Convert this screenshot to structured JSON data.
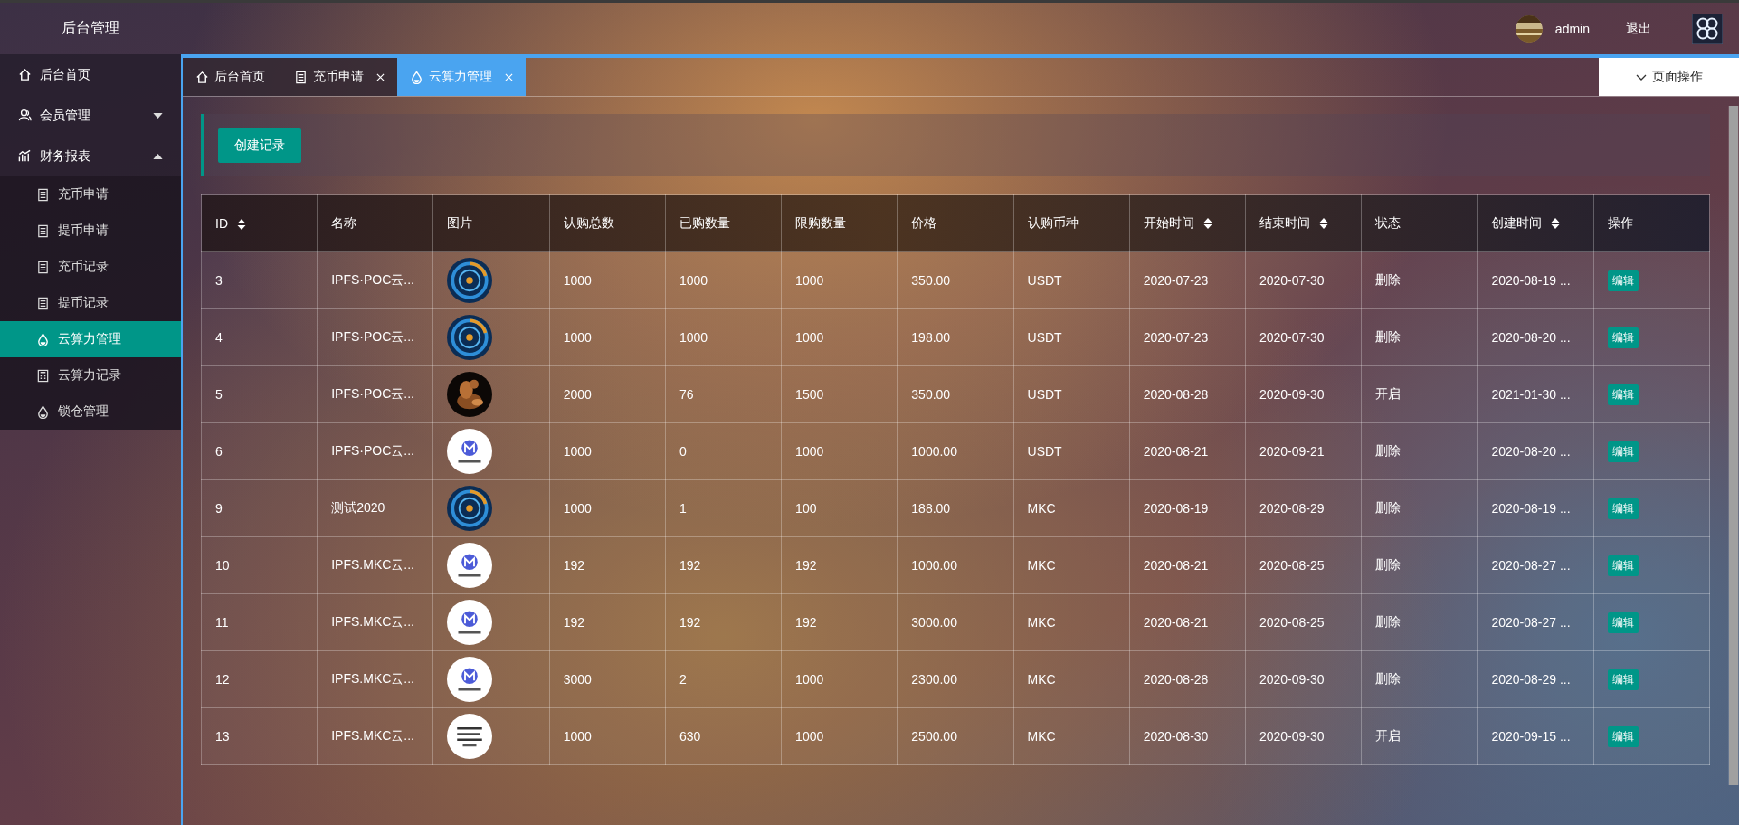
{
  "header": {
    "title": "后台管理",
    "user": "admin",
    "logout": "退出"
  },
  "sidebar": {
    "items": [
      {
        "label": "后台首页",
        "selected": false
      },
      {
        "label": "会员管理",
        "selected": false,
        "expanded": false
      },
      {
        "label": "财务报表",
        "selected": false,
        "expanded": true,
        "children": [
          {
            "label": "充币申请",
            "selected": false
          },
          {
            "label": "提币申请",
            "selected": false
          },
          {
            "label": "充币记录",
            "selected": false
          },
          {
            "label": "提币记录",
            "selected": false
          },
          {
            "label": "云算力管理",
            "selected": true
          },
          {
            "label": "云算力记录",
            "selected": false
          },
          {
            "label": "锁仓管理",
            "selected": false
          }
        ]
      }
    ]
  },
  "tabs": [
    {
      "label": "后台首页",
      "selected": false,
      "closable": false
    },
    {
      "label": "充币申请",
      "selected": false,
      "closable": true
    },
    {
      "label": "云算力管理",
      "selected": true,
      "closable": true
    }
  ],
  "page_actions": "页面操作",
  "create_button": "创建记录",
  "table": {
    "columns": [
      {
        "label": "ID",
        "sortable": true
      },
      {
        "label": "名称",
        "sortable": false
      },
      {
        "label": "图片",
        "sortable": false
      },
      {
        "label": "认购总数",
        "sortable": false
      },
      {
        "label": "已购数量",
        "sortable": false
      },
      {
        "label": "限购数量",
        "sortable": false
      },
      {
        "label": "价格",
        "sortable": false
      },
      {
        "label": "认购币种",
        "sortable": false
      },
      {
        "label": "开始时间",
        "sortable": true
      },
      {
        "label": "结束时间",
        "sortable": true
      },
      {
        "label": "状态",
        "sortable": false
      },
      {
        "label": "创建时间",
        "sortable": true
      },
      {
        "label": "操作",
        "sortable": false
      }
    ],
    "rows": [
      {
        "id": "3",
        "name": "IPFS·POC云...",
        "total": "1000",
        "bought": "1000",
        "limit": "1000",
        "price": "350.00",
        "coin": "USDT",
        "start": "2020-07-23",
        "end": "2020-07-30",
        "status": "删除",
        "created": "2020-08-19 ...",
        "action": "编辑"
      },
      {
        "id": "4",
        "name": "IPFS·POC云...",
        "total": "1000",
        "bought": "1000",
        "limit": "1000",
        "price": "198.00",
        "coin": "USDT",
        "start": "2020-07-23",
        "end": "2020-07-30",
        "status": "删除",
        "created": "2020-08-20 ...",
        "action": "编辑"
      },
      {
        "id": "5",
        "name": "IPFS·POC云...",
        "total": "2000",
        "bought": "76",
        "limit": "1500",
        "price": "350.00",
        "coin": "USDT",
        "start": "2020-08-28",
        "end": "2020-09-30",
        "status": "开启",
        "created": "2021-01-30 ...",
        "action": "编辑"
      },
      {
        "id": "6",
        "name": "IPFS·POC云...",
        "total": "1000",
        "bought": "0",
        "limit": "1000",
        "price": "1000.00",
        "coin": "USDT",
        "start": "2020-08-21",
        "end": "2020-09-21",
        "status": "删除",
        "created": "2020-08-20 ...",
        "action": "编辑"
      },
      {
        "id": "9",
        "name": "测试2020",
        "total": "1000",
        "bought": "1",
        "limit": "100",
        "price": "188.00",
        "coin": "MKC",
        "start": "2020-08-19",
        "end": "2020-08-29",
        "status": "删除",
        "created": "2020-08-19 ...",
        "action": "编辑"
      },
      {
        "id": "10",
        "name": "IPFS.MKC云...",
        "total": "192",
        "bought": "192",
        "limit": "192",
        "price": "1000.00",
        "coin": "MKC",
        "start": "2020-08-21",
        "end": "2020-08-25",
        "status": "删除",
        "created": "2020-08-27 ...",
        "action": "编辑"
      },
      {
        "id": "11",
        "name": "IPFS.MKC云...",
        "total": "192",
        "bought": "192",
        "limit": "192",
        "price": "3000.00",
        "coin": "MKC",
        "start": "2020-08-21",
        "end": "2020-08-25",
        "status": "删除",
        "created": "2020-08-27 ...",
        "action": "编辑"
      },
      {
        "id": "12",
        "name": "IPFS.MKC云...",
        "total": "3000",
        "bought": "2",
        "limit": "1000",
        "price": "2300.00",
        "coin": "MKC",
        "start": "2020-08-28",
        "end": "2020-09-30",
        "status": "删除",
        "created": "2020-08-29 ...",
        "action": "编辑"
      },
      {
        "id": "13",
        "name": "IPFS.MKC云...",
        "total": "1000",
        "bought": "630",
        "limit": "1000",
        "price": "2500.00",
        "coin": "MKC",
        "start": "2020-08-30",
        "end": "2020-09-30",
        "status": "开启",
        "created": "2020-09-15 ...",
        "action": "编辑"
      }
    ]
  }
}
